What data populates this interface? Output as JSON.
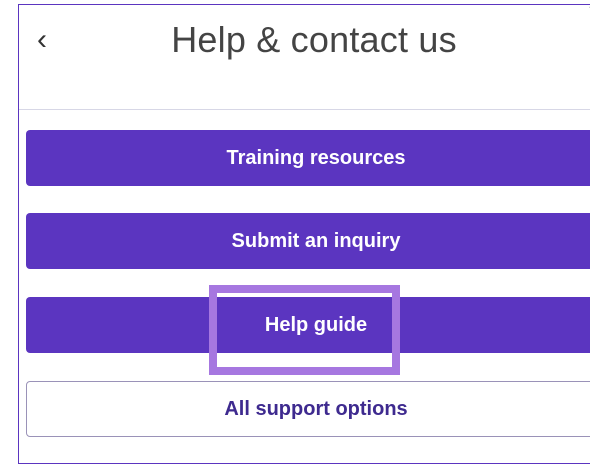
{
  "header": {
    "title": "Help & contact us",
    "back_icon": "chevron-left-icon",
    "close_icon": "close-icon"
  },
  "buttons": [
    {
      "label": "Training resources",
      "style": "primary"
    },
    {
      "label": "Submit an inquiry",
      "style": "primary"
    },
    {
      "label": "Help guide",
      "style": "primary",
      "highlighted": true
    },
    {
      "label": "All support options",
      "style": "secondary"
    }
  ],
  "colors": {
    "primary": "#5b35c0",
    "secondary_text": "#3e2a8f",
    "highlight": "#a677e0"
  }
}
